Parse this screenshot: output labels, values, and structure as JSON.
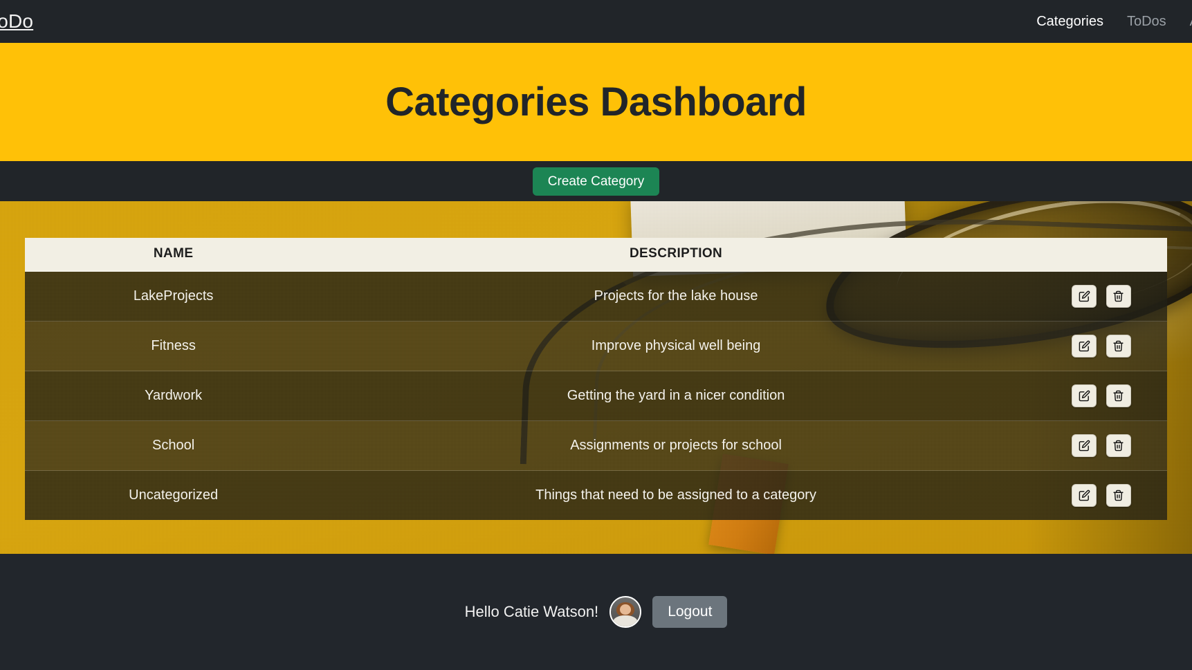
{
  "navbar": {
    "brand": "ToDo",
    "links": [
      {
        "label": "Categories",
        "active": true
      },
      {
        "label": "ToDos",
        "active": false
      },
      {
        "label": "A",
        "active": false
      }
    ]
  },
  "hero": {
    "title": "Categories Dashboard"
  },
  "action_bar": {
    "create_label": "Create Category"
  },
  "table": {
    "headers": {
      "name": "NAME",
      "description": "DESCRIPTION",
      "actions": ""
    },
    "rows": [
      {
        "name": "LakeProjects",
        "description": "Projects for the lake house"
      },
      {
        "name": "Fitness",
        "description": "Improve physical well being"
      },
      {
        "name": "Yardwork",
        "description": "Getting the yard in a nicer condition"
      },
      {
        "name": "School",
        "description": "Assignments or projects for school"
      },
      {
        "name": "Uncategorized",
        "description": "Things that need to be assigned to a category"
      }
    ],
    "row_actions": {
      "edit_icon": "edit-pencil-icon",
      "delete_icon": "trash-icon"
    }
  },
  "footer": {
    "greeting": "Hello Catie Watson!",
    "avatar": "user-avatar",
    "logout_label": "Logout"
  },
  "colors": {
    "navbar_bg": "#212529",
    "hero_bg": "#ffc107",
    "hero_text": "#212529",
    "create_button": "#1c8554",
    "logout_button": "#6c757d",
    "table_header_bg": "#f2efe4",
    "row_text": "#f4f2ec",
    "footer_bg": "#22262c"
  }
}
